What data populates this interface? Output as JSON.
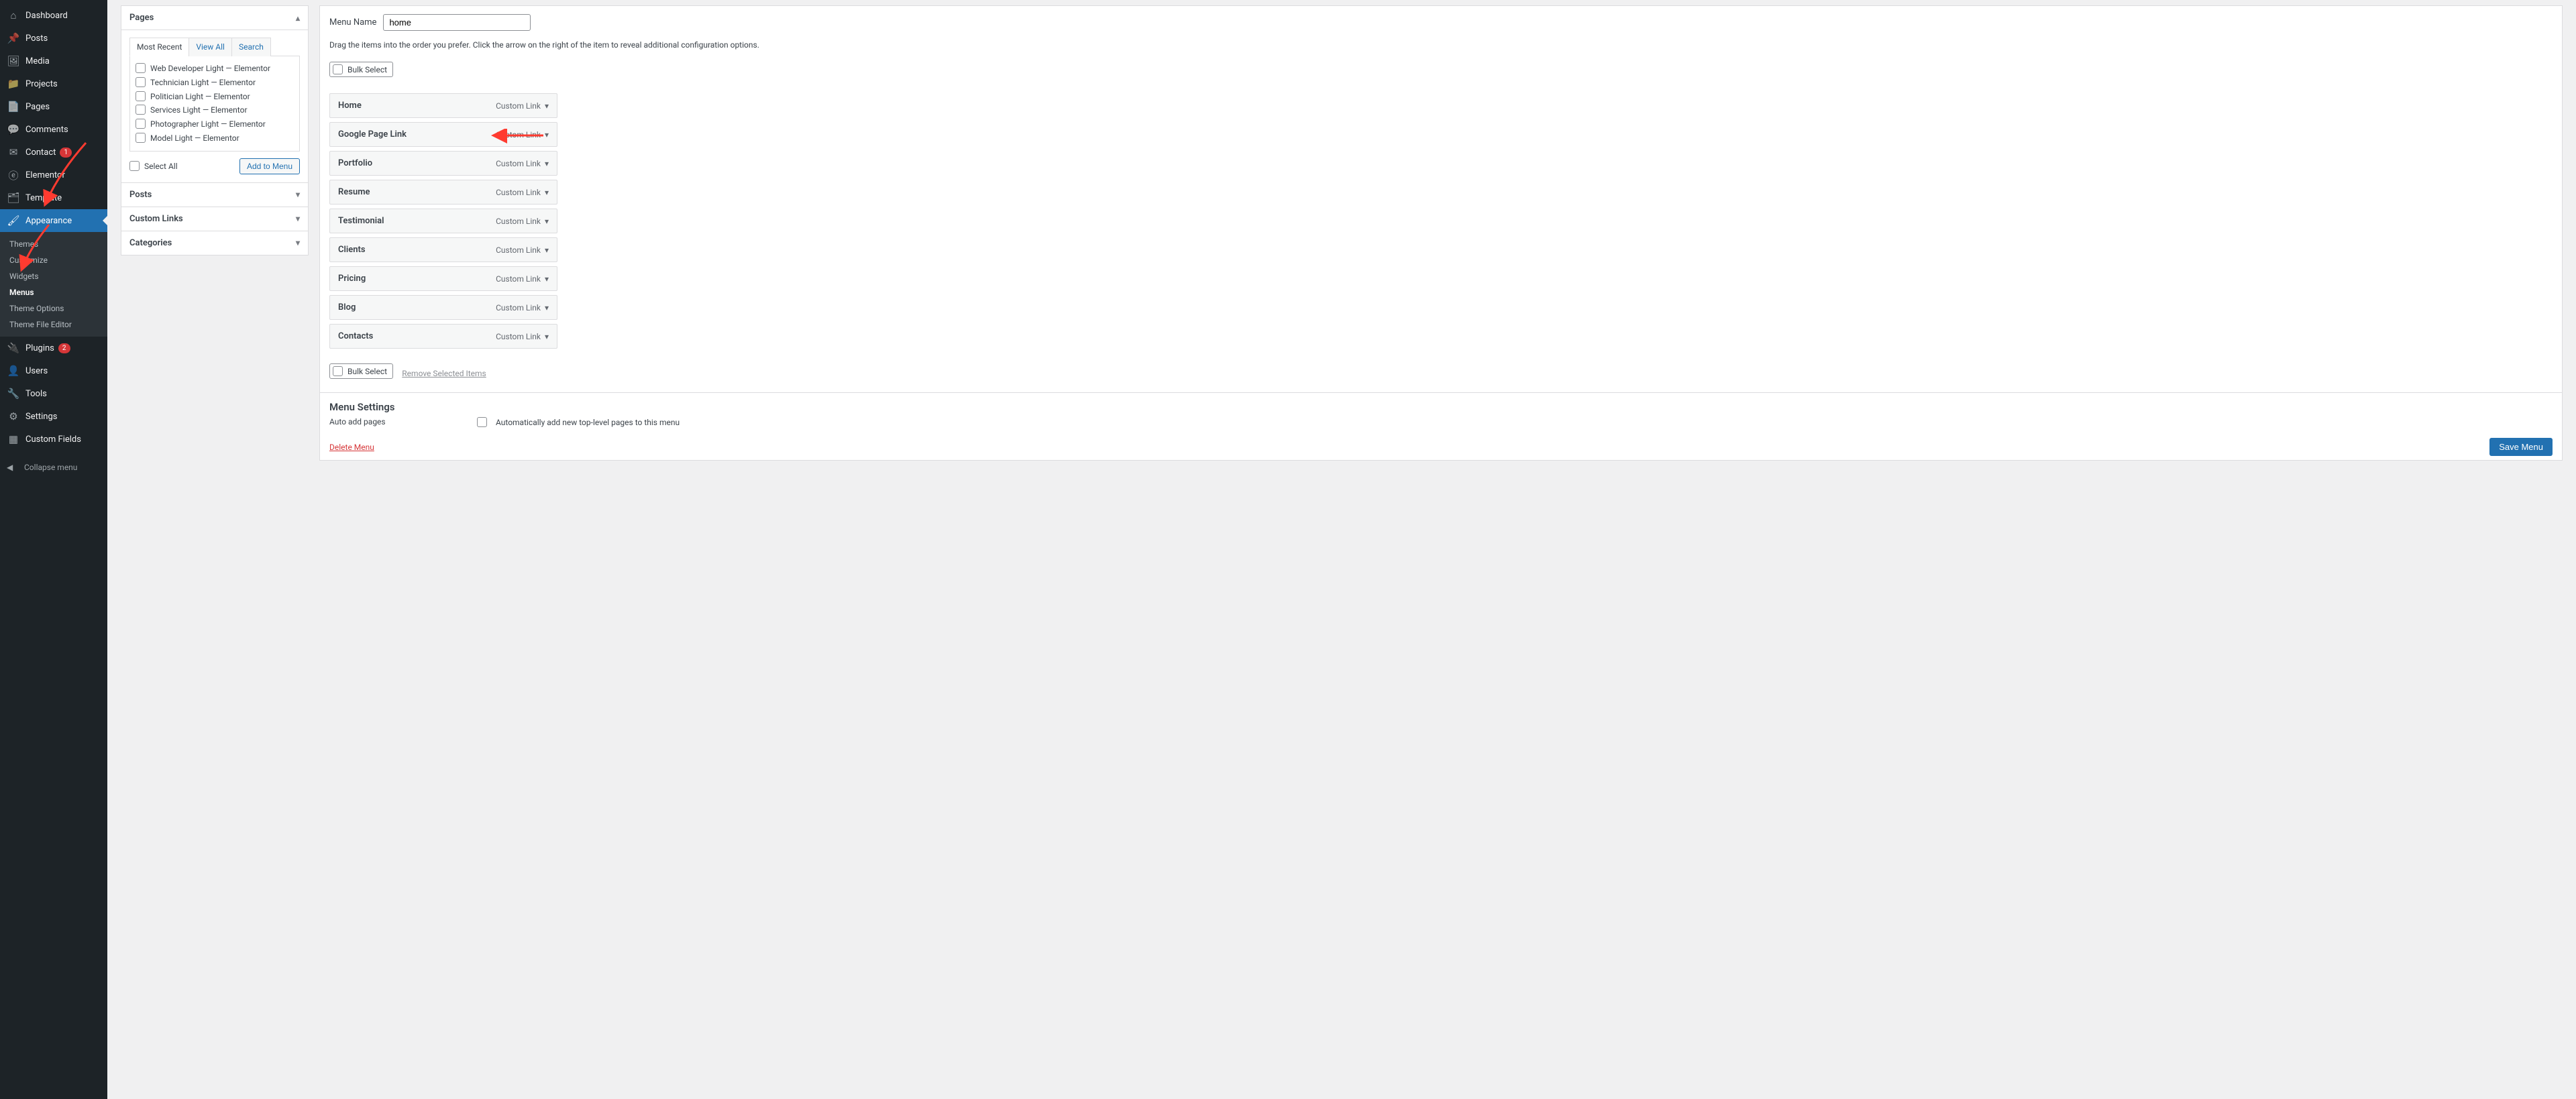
{
  "sidebar": {
    "items": [
      {
        "label": "Dashboard",
        "icon": "⌂"
      },
      {
        "label": "Posts",
        "icon": "📌"
      },
      {
        "label": "Media",
        "icon": "🖼"
      },
      {
        "label": "Projects",
        "icon": "📁"
      },
      {
        "label": "Pages",
        "icon": "📄"
      },
      {
        "label": "Comments",
        "icon": "💬"
      },
      {
        "label": "Contact",
        "icon": "✉",
        "badge": "1"
      },
      {
        "label": "Elementor",
        "icon": "ⓔ"
      },
      {
        "label": "Template",
        "icon": "🗂"
      },
      {
        "label": "Appearance",
        "icon": "🖌",
        "active": true
      },
      {
        "label": "Plugins",
        "icon": "🔌",
        "badge": "2"
      },
      {
        "label": "Users",
        "icon": "👤"
      },
      {
        "label": "Tools",
        "icon": "🔧"
      },
      {
        "label": "Settings",
        "icon": "⚙"
      },
      {
        "label": "Custom Fields",
        "icon": "▦"
      }
    ],
    "submenu": [
      {
        "label": "Themes"
      },
      {
        "label": "Customize"
      },
      {
        "label": "Widgets"
      },
      {
        "label": "Menus",
        "current": true
      },
      {
        "label": "Theme Options"
      },
      {
        "label": "Theme File Editor"
      }
    ],
    "collapse": "Collapse menu"
  },
  "left": {
    "pages_title": "Pages",
    "tabs": {
      "recent": "Most Recent",
      "all": "View All",
      "search": "Search"
    },
    "page_items": [
      "Web Developer Light — Elementor",
      "Technician Light — Elementor",
      "Politician Light — Elementor",
      "Services Light — Elementor",
      "Photographer Light — Elementor",
      "Model Light — Elementor"
    ],
    "select_all": "Select All",
    "add_to_menu": "Add to Menu",
    "posts_title": "Posts",
    "custom_links_title": "Custom Links",
    "categories_title": "Categories"
  },
  "editor": {
    "menu_name_label": "Menu Name",
    "menu_name_value": "home",
    "hint": "Drag the items into the order you prefer. Click the arrow on the right of the item to reveal additional configuration options.",
    "bulk_select": "Bulk Select",
    "items": [
      {
        "title": "Home",
        "type": "Custom Link"
      },
      {
        "title": "Google Page Link",
        "type": "Custom Link"
      },
      {
        "title": "Portfolio",
        "type": "Custom Link"
      },
      {
        "title": "Resume",
        "type": "Custom Link"
      },
      {
        "title": "Testimonial",
        "type": "Custom Link"
      },
      {
        "title": "Clients",
        "type": "Custom Link"
      },
      {
        "title": "Pricing",
        "type": "Custom Link"
      },
      {
        "title": "Blog",
        "type": "Custom Link"
      },
      {
        "title": "Contacts",
        "type": "Custom Link"
      }
    ],
    "remove_selected": "Remove Selected Items",
    "settings_title": "Menu Settings",
    "auto_add_label": "Auto add pages",
    "auto_add_check": "Automatically add new top-level pages to this menu",
    "delete_menu": "Delete Menu",
    "save_menu": "Save Menu"
  }
}
